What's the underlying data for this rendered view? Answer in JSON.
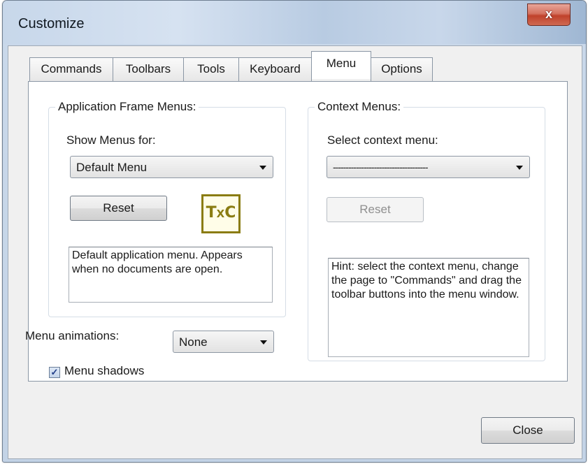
{
  "window": {
    "title": "Customize",
    "close_glyph": "x"
  },
  "tabs": [
    {
      "label": "Commands"
    },
    {
      "label": "Toolbars"
    },
    {
      "label": "Tools"
    },
    {
      "label": "Keyboard"
    },
    {
      "label": "Menu"
    },
    {
      "label": "Options"
    }
  ],
  "active_tab": "Menu",
  "app_frame": {
    "group_label": "Application Frame Menus:",
    "show_menus_label": "Show Menus for:",
    "show_menus_value": "Default Menu",
    "reset_label": "Reset",
    "logo_text": "TXC",
    "description": "Default application menu. Appears when no documents are open."
  },
  "context": {
    "group_label": "Context Menus:",
    "select_label": "Select context menu:",
    "select_value": "-------------------------------------",
    "reset_label": "Reset",
    "hint": "Hint: select the context menu, change the page to \"Commands\" and drag the toolbar buttons into the menu window."
  },
  "animations": {
    "label": "Menu animations:",
    "value": "None"
  },
  "shadows": {
    "label": "Menu shadows",
    "checked": true
  },
  "footer": {
    "close_label": "Close"
  },
  "colors": {
    "logo": "#8a7c12",
    "title_bar": "#c7d7ea",
    "close_button": "#c0412a"
  }
}
